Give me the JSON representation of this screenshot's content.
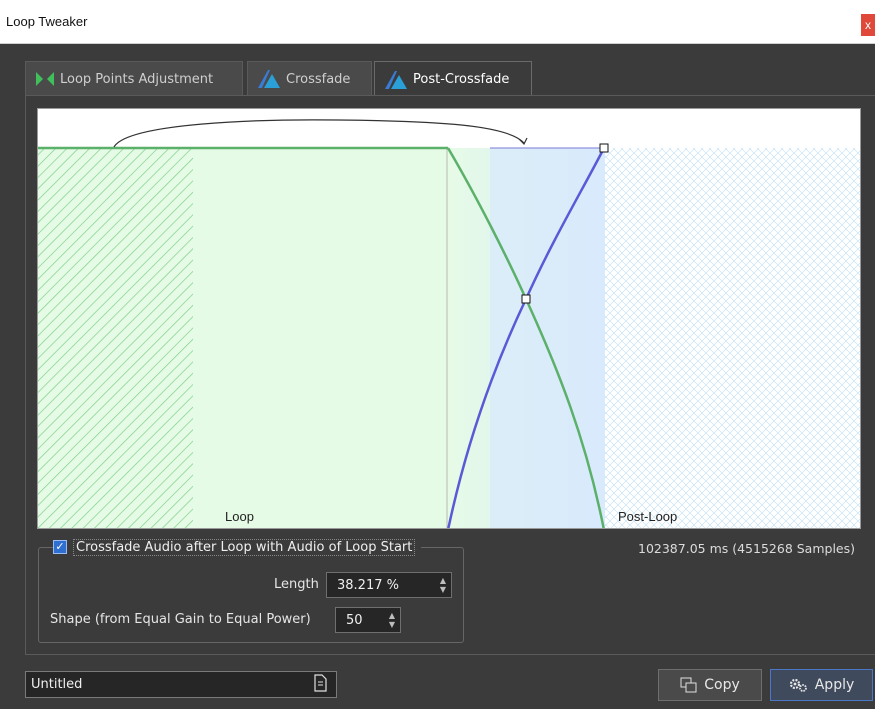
{
  "window": {
    "title": "Loop Tweaker",
    "close_glyph": "x"
  },
  "tabs": [
    {
      "label": "Loop Points Adjustment",
      "icon": "loop-points-icon",
      "active": false
    },
    {
      "label": "Crossfade",
      "icon": "crossfade-icon",
      "active": false
    },
    {
      "label": "Post-Crossfade",
      "icon": "post-crossfade-icon",
      "active": true
    }
  ],
  "graph": {
    "region_left_label": "Loop",
    "region_right_label": "Post-Loop",
    "colors": {
      "loop_fill": "#e6fbe6",
      "crossfade_fill": "#d8eafc",
      "fade_out_curve": "#5bb06a",
      "fade_in_curve": "#5a5ad6",
      "arrow": "#333333"
    }
  },
  "options": {
    "crossfade_checkbox_label": "Crossfade Audio after Loop with Audio of Loop Start",
    "crossfade_checked": true,
    "length_label": "Length",
    "length_value": "38.217 %",
    "shape_label": "Shape (from Equal Gain to Equal Power)",
    "shape_value": "50"
  },
  "info_text": "102387.05 ms (4515268 Samples)",
  "footer": {
    "preset_name": "Untitled",
    "copy_label": "Copy",
    "apply_label": "Apply"
  },
  "accent_color": "#2f6fd2"
}
